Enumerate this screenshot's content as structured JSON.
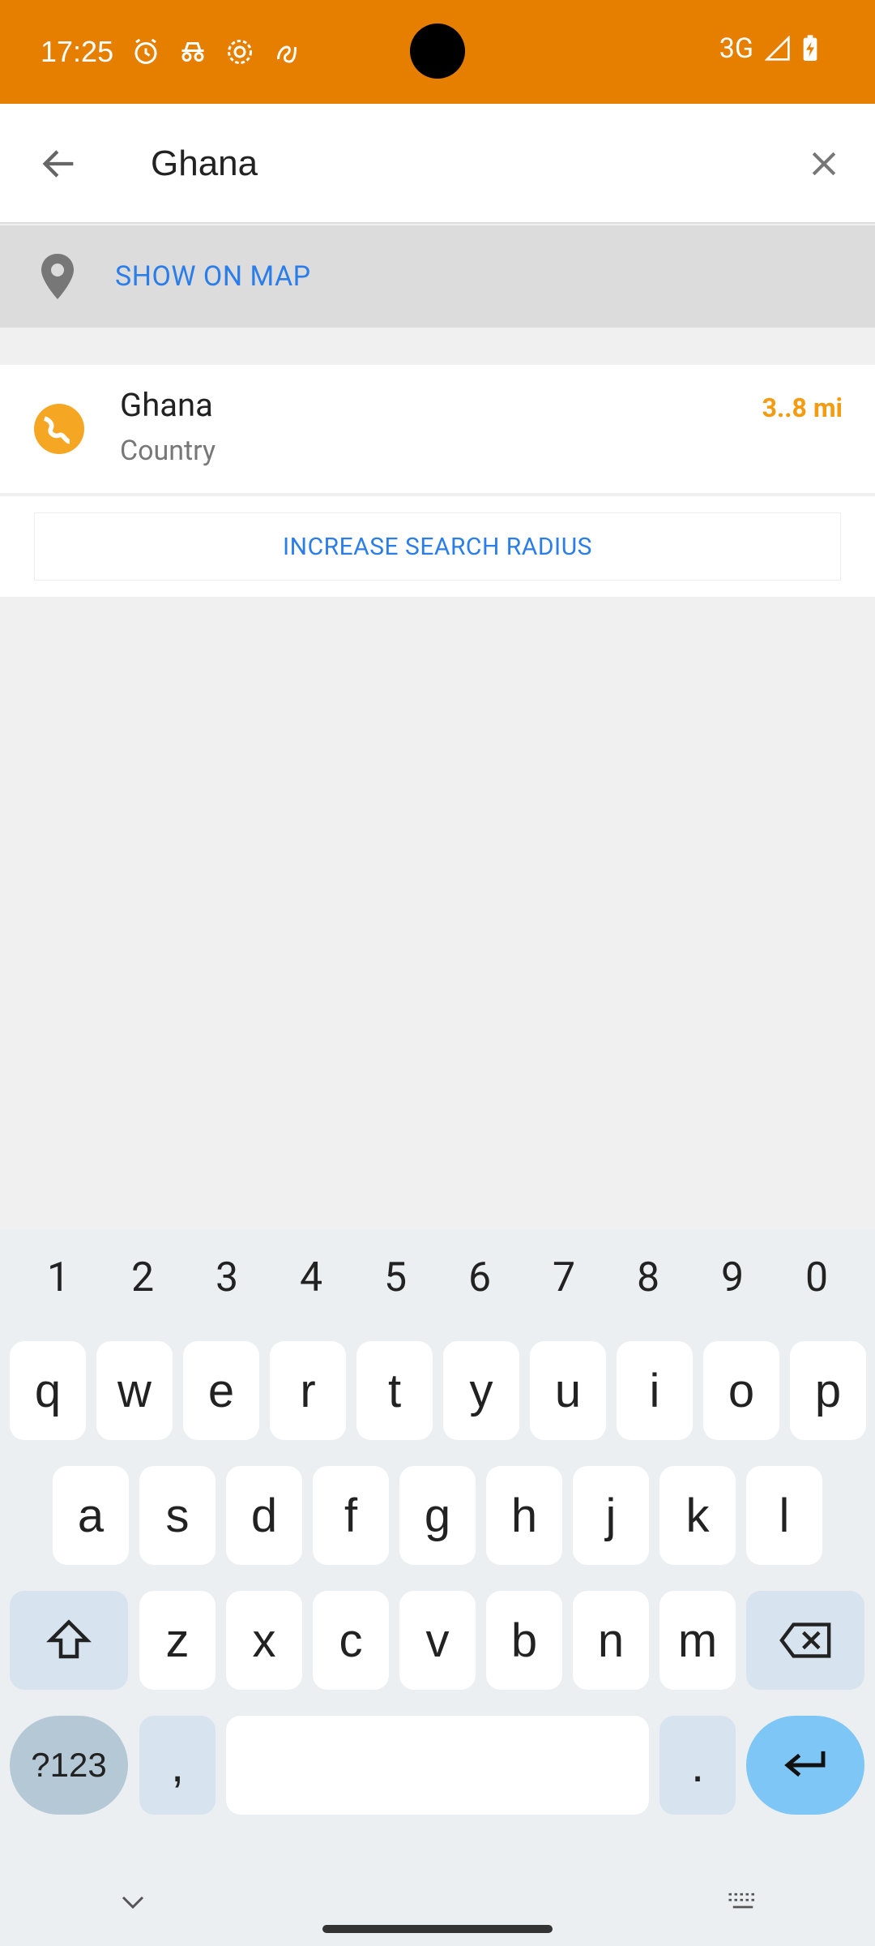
{
  "status_bar": {
    "time": "17:25",
    "network": "3G",
    "icons": [
      "alarm-icon",
      "incognito-icon",
      "settings-gear-icon",
      "bolt-icon"
    ]
  },
  "search": {
    "value": "Ghana",
    "back_icon": "arrow-left-icon",
    "clear_icon": "close-icon"
  },
  "map": {
    "label": "SHOW ON MAP",
    "icon": "map-pin-icon"
  },
  "results": [
    {
      "title": "Ghana",
      "subtitle": "Country",
      "distance": "3..8 mi",
      "icon": "globe-icon"
    }
  ],
  "radius": {
    "label": "INCREASE SEARCH RADIUS"
  },
  "keyboard": {
    "numbers": [
      "1",
      "2",
      "3",
      "4",
      "5",
      "6",
      "7",
      "8",
      "9",
      "0"
    ],
    "row1": [
      "q",
      "w",
      "e",
      "r",
      "t",
      "y",
      "u",
      "i",
      "o",
      "p"
    ],
    "row2": [
      "a",
      "s",
      "d",
      "f",
      "g",
      "h",
      "j",
      "k",
      "l"
    ],
    "row3": [
      "z",
      "x",
      "c",
      "v",
      "b",
      "n",
      "m"
    ],
    "sym_label": "?123",
    "comma": ",",
    "period": "."
  },
  "colors": {
    "status_bar": "#E67E00",
    "accent_link": "#2b7de9",
    "distance": "#F39C12"
  }
}
